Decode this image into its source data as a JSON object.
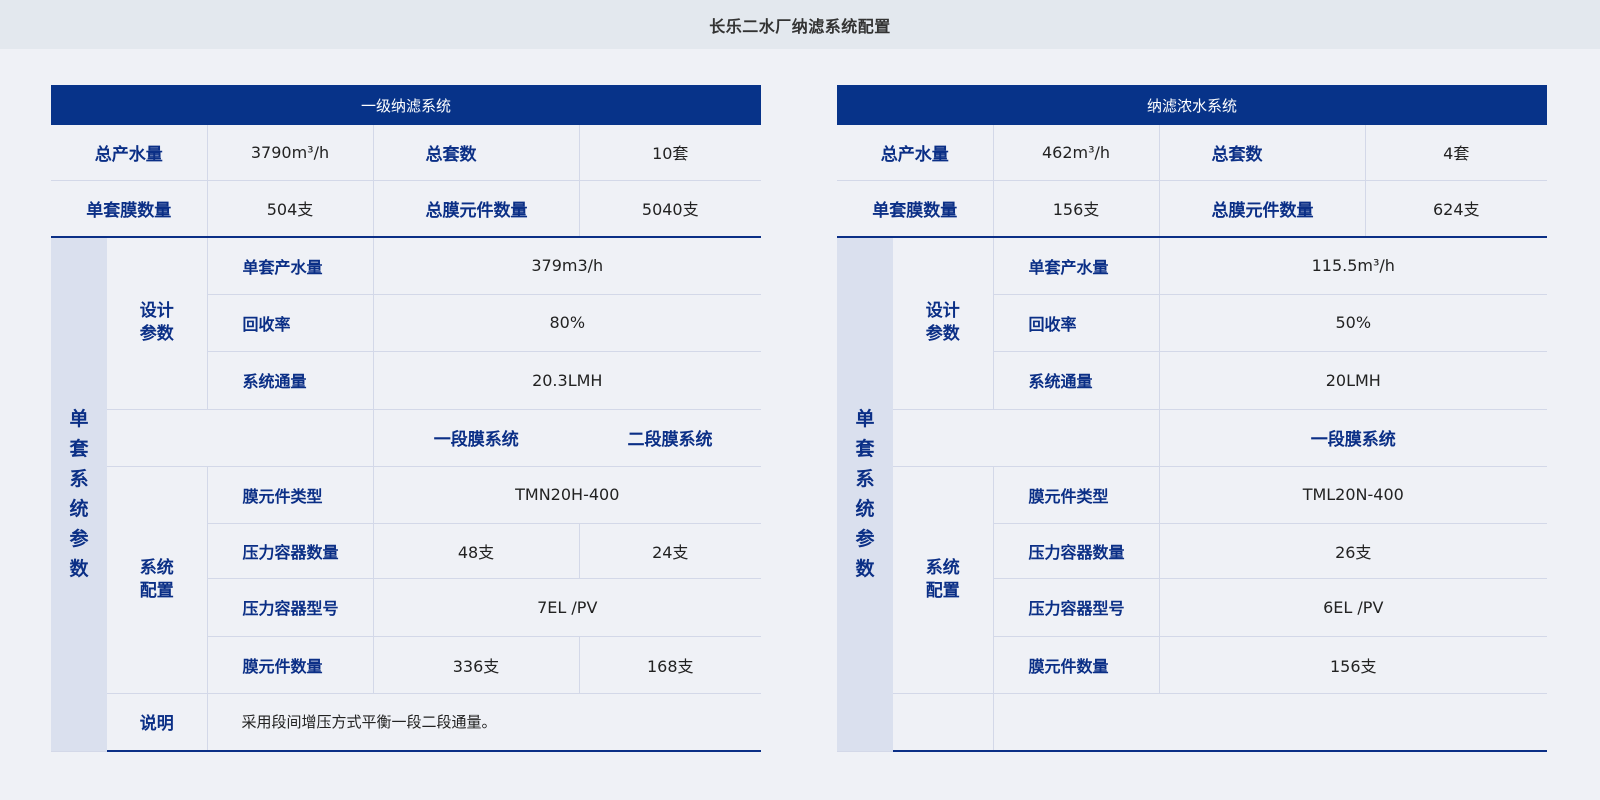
{
  "page_title": "长乐二水厂纳滤系统配置",
  "left": {
    "header": "一级纳滤系统",
    "summary": {
      "total_output_label": "总产水量",
      "total_output_value": "3790m³/h",
      "total_sets_label": "总套数",
      "total_sets_value": "10套",
      "per_set_membranes_label": "单套膜数量",
      "per_set_membranes_value": "504支",
      "total_elements_label": "总膜元件数量",
      "total_elements_value": "5040支"
    },
    "side_label": "单套系统参数",
    "design_group_label": "设计参数",
    "design": [
      {
        "label": "单套产水量",
        "value": "379m3/h"
      },
      {
        "label": "回收率",
        "value": "80%"
      },
      {
        "label": "系统通量",
        "value": "20.3LMH"
      }
    ],
    "stages": [
      "一段膜系统",
      "二段膜系统"
    ],
    "config_group_label": "系统配置",
    "config": {
      "element_type_label": "膜元件类型",
      "element_type_value": "TMN20H-400",
      "vessel_count_label": "压力容器数量",
      "vessel_count_values": [
        "48支",
        "24支"
      ],
      "vessel_model_label": "压力容器型号",
      "vessel_model_value": "7EL /PV",
      "element_count_label": "膜元件数量",
      "element_count_values": [
        "336支",
        "168支"
      ]
    },
    "note_label": "说明",
    "note_value": "采用段间增压方式平衡一段二段通量。"
  },
  "right": {
    "header": "纳滤浓水系统",
    "summary": {
      "total_output_label": "总产水量",
      "total_output_value": "462m³/h",
      "total_sets_label": "总套数",
      "total_sets_value": "4套",
      "per_set_membranes_label": "单套膜数量",
      "per_set_membranes_value": "156支",
      "total_elements_label": "总膜元件数量",
      "total_elements_value": "624支"
    },
    "side_label": "单套系统参数",
    "design_group_label": "设计参数",
    "design": [
      {
        "label": "单套产水量",
        "value": "115.5m³/h"
      },
      {
        "label": "回收率",
        "value": "50%"
      },
      {
        "label": "系统通量",
        "value": "20LMH"
      }
    ],
    "stages": [
      "一段膜系统"
    ],
    "config_group_label": "系统配置",
    "config": {
      "element_type_label": "膜元件类型",
      "element_type_value": "TML20N-400",
      "vessel_count_label": "压力容器数量",
      "vessel_count_value": "26支",
      "vessel_model_label": "压力容器型号",
      "vessel_model_value": "6EL /PV",
      "element_count_label": "膜元件数量",
      "element_count_value": "156支"
    }
  },
  "colors": {
    "header_bg": "#073389",
    "label_text": "#0b2f86",
    "side_bg": "#dae0ee",
    "page_bg": "#eff1f6",
    "topbar_bg": "#e3e8ee"
  }
}
